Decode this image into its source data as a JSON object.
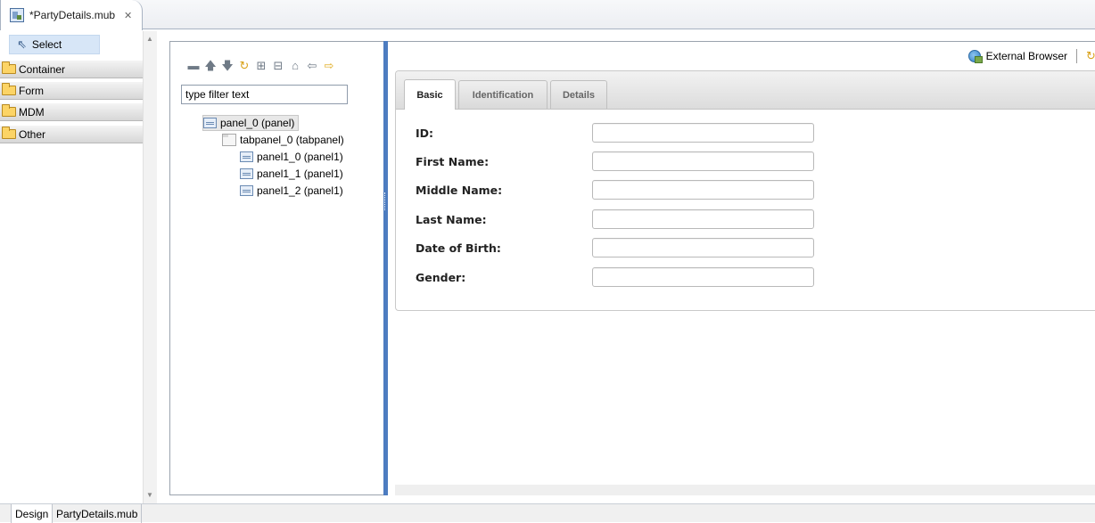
{
  "editor": {
    "tab_title": "*PartyDetails.mub",
    "close_glyph": "✕"
  },
  "palette": {
    "select_label": "Select",
    "drawers": [
      {
        "label": "Container"
      },
      {
        "label": "Form"
      },
      {
        "label": "MDM"
      },
      {
        "label": "Other"
      }
    ]
  },
  "outline": {
    "toolbar_icons": [
      "collapse-icon",
      "move-up-icon",
      "move-down-icon",
      "refresh-icon",
      "expand-all-icon",
      "collapse-all-icon",
      "home-icon",
      "back-icon",
      "forward-icon"
    ],
    "filter_placeholder": "type filter text",
    "filter_value": "type filter text",
    "tree": [
      {
        "label": "panel_0 (panel)",
        "level": 0,
        "selected": true,
        "icon": "panel-icon"
      },
      {
        "label": "tabpanel_0 (tabpanel)",
        "level": 1,
        "selected": false,
        "icon": "tabpanel-icon"
      },
      {
        "label": "panel1_0 (panel1)",
        "level": 2,
        "selected": false,
        "icon": "panel-icon"
      },
      {
        "label": "panel1_1 (panel1)",
        "level": 2,
        "selected": false,
        "icon": "panel-icon"
      },
      {
        "label": "panel1_2 (panel1)",
        "level": 2,
        "selected": false,
        "icon": "panel-icon"
      }
    ]
  },
  "preview": {
    "external_browser_label": "External Browser",
    "tabs": [
      {
        "label": "Basic",
        "active": true
      },
      {
        "label": "Identification",
        "active": false
      },
      {
        "label": "Details",
        "active": false
      }
    ],
    "fields": [
      {
        "label": "ID:",
        "value": ""
      },
      {
        "label": "First Name:",
        "value": ""
      },
      {
        "label": "Middle Name:",
        "value": ""
      },
      {
        "label": "Last Name:",
        "value": ""
      },
      {
        "label": "Date of Birth:",
        "value": ""
      },
      {
        "label": "Gender:",
        "value": ""
      }
    ]
  },
  "bottom_tabs": [
    {
      "label": "Design",
      "active": true
    },
    {
      "label": "PartyDetails.mub",
      "active": false
    }
  ],
  "colors": {
    "splitter": "#4d7cc0",
    "selection": "#d7e6f7"
  }
}
